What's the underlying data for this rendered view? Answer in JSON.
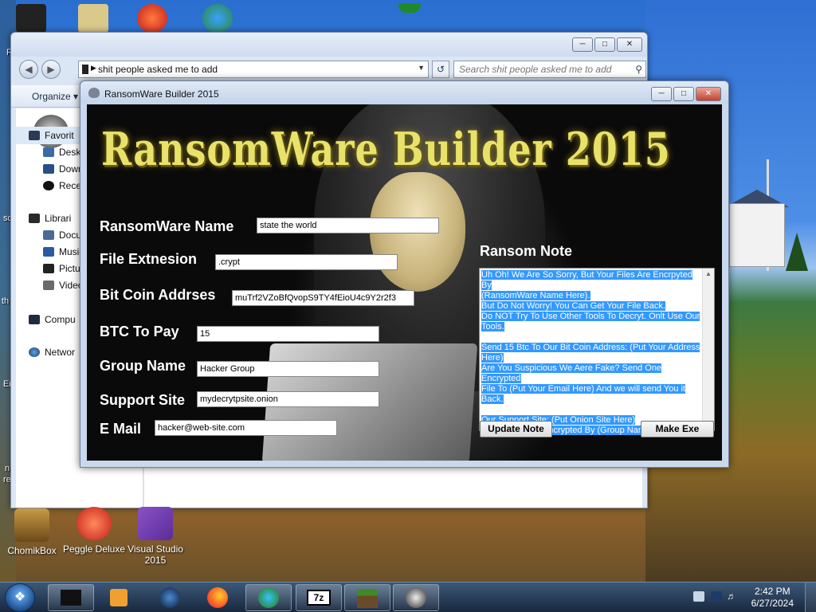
{
  "explorer": {
    "address": "shit people asked me to add",
    "search_placeholder": "Search shit people asked me to add",
    "organize_label": "Organize",
    "nav_items": [
      "Favorit",
      "Deskt",
      "Down",
      "Recen",
      "Librari",
      "Docu",
      "Music",
      "Pictu",
      "Video",
      "Compu",
      "Networ"
    ]
  },
  "builder": {
    "window_title": "RansomWare Builder 2015",
    "logo_text": "RansomWare Builder 2015",
    "fields": [
      {
        "label": "RansomWare Name",
        "value": "state the world"
      },
      {
        "label": "File Extnesion",
        "value": ".crypt"
      },
      {
        "label": "Bit Coin Addrses",
        "value": "muTrf2VZoBfQvopS9TY4fEioU4c9Y2r2f3"
      },
      {
        "label": "BTC To Pay",
        "value": "15"
      },
      {
        "label": "Group Name",
        "value": "Hacker Group"
      },
      {
        "label": "Support Site",
        "value": "mydecrytpsite.onion"
      },
      {
        "label": "E Mail",
        "value": "hacker@web-site.com"
      }
    ],
    "ransom_note_label": "Ransom Note",
    "note_lines": [
      "Uh Oh! We Are So Sorry, But Your Files Are Encrpyted By",
      "(RansomWare Name Here).",
      "But Do Not Worry! You Can Get Your File Back.",
      "Do NOT Try To Use Other Tools To Decryt. Onlt Use Our",
      "Tools.",
      "",
      "Send 15 Btc To Our Bit Coin Address: (Put Your Address",
      "Here)",
      "Are You Suspicious We Aere Fake? Send One Encrypted",
      "File To (Put Your Email Here) And we will send You it",
      "Back.",
      "",
      "Our Support Site: (Put Onion Site Here)",
      "You Files Were Encrypted By (Group Name)"
    ],
    "update_button": "Update Note",
    "make_button": "Make Exe"
  },
  "desktop": {
    "icons": [
      {
        "label": "ChomikBox"
      },
      {
        "label": "Peggle Deluxe"
      },
      {
        "label": "Visual Studio 2015"
      }
    ],
    "left_fragments": [
      "R",
      "sc",
      "th",
      "Er",
      "n",
      "re"
    ]
  },
  "taskbar": {
    "time": "2:42 PM",
    "date": "6/27/2024",
    "apps": [
      "terminal-app",
      "media-player",
      "browser-globe",
      "firefox",
      "edge",
      "7zip",
      "minecraft",
      "skull-app"
    ]
  },
  "colors": {
    "logo": "#e8e26a",
    "selection": "#3399ff",
    "label_text": "#ffffff"
  }
}
